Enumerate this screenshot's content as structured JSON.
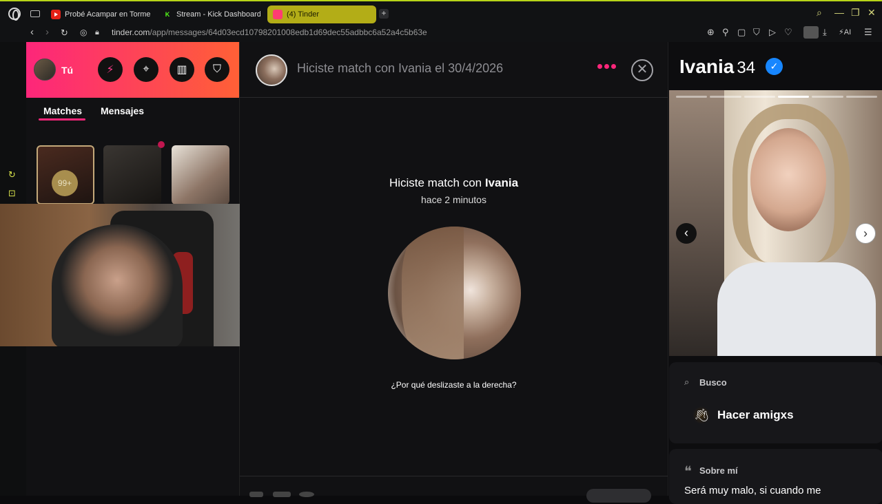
{
  "browser": {
    "tabs": [
      {
        "label": "Probé Acampar en Tormenta",
        "favicon": "youtube-icon"
      },
      {
        "label": "Stream - Kick Dashboard",
        "favicon": "kick-icon"
      },
      {
        "label": "(4) Tinder",
        "favicon": "tinder-icon",
        "active": true
      }
    ],
    "url_host": "tinder.com",
    "url_path": "/app/messages/64d03ecd10798201008edb1d69dec55adbbc6a52a4c5b63e",
    "ai_label": "AI",
    "accent": "#b8d418"
  },
  "left": {
    "me_label": "Tú",
    "tabs": {
      "matches": "Matches",
      "mensajes": "Mensajes"
    },
    "badge": "99+",
    "gradient": [
      "#fd267a",
      "#ff6036"
    ]
  },
  "chat": {
    "header_title": "Hiciste match con Ivania el 30/4/2026",
    "match_prefix": "Hiciste match con ",
    "match_name": "Ivania",
    "time_ago": "hace 2 minutos",
    "why_link": "¿Por qué deslizaste a la derecha?"
  },
  "profile": {
    "name": "Ivania",
    "age": "34",
    "photo_count": 6,
    "photo_index": 4,
    "busco_label": "Busco",
    "busco_value": "Hacer amigxs",
    "sobre_label": "Sobre mí",
    "sobre_text": "Será muy malo, si cuando me"
  }
}
